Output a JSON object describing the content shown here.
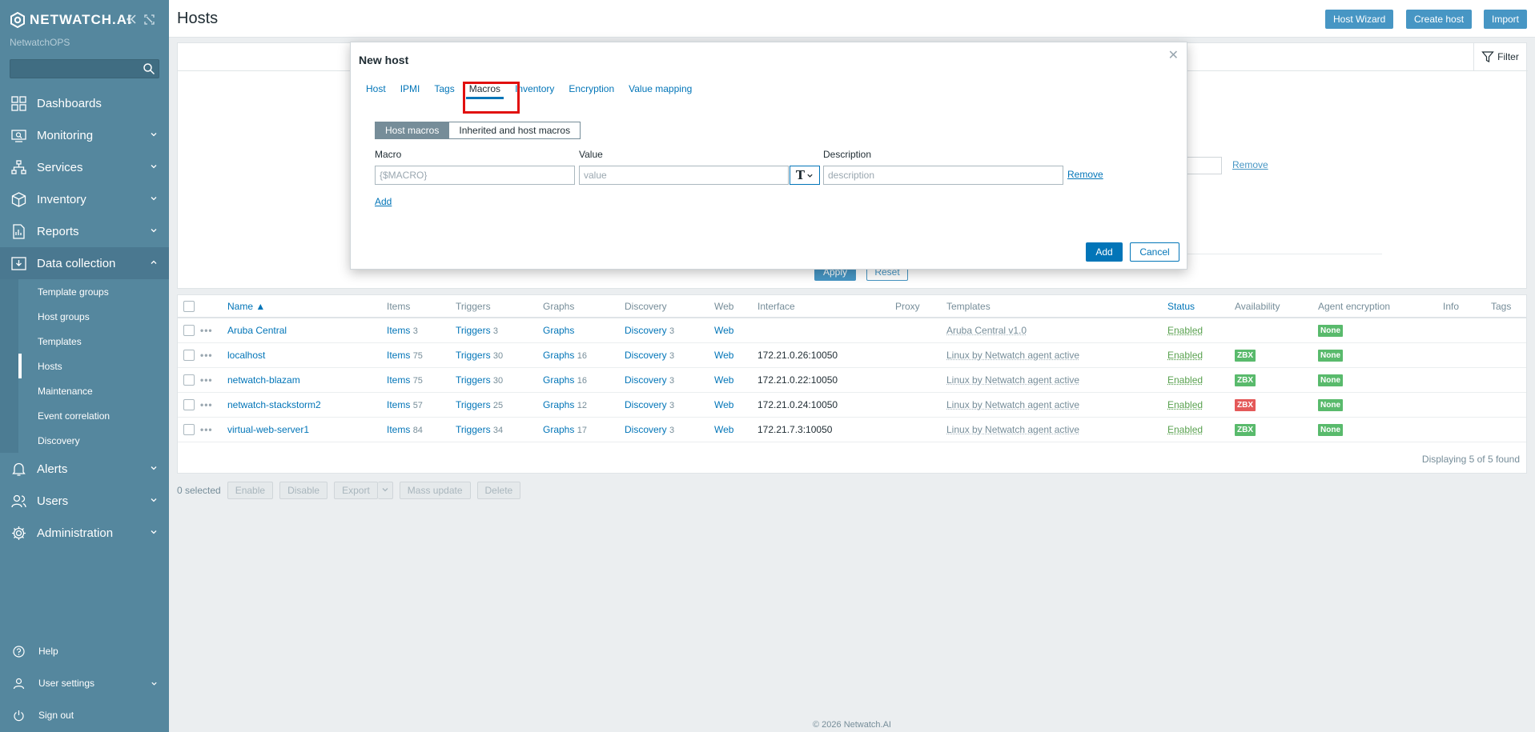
{
  "app": {
    "brand": "NETWATCH.AI",
    "subtitle": "NetwatchOPS",
    "search_placeholder": ""
  },
  "sidebar": {
    "menu": [
      {
        "label": "Dashboards",
        "icon": "dashboards-icon"
      },
      {
        "label": "Monitoring",
        "icon": "monitoring-icon"
      },
      {
        "label": "Services",
        "icon": "services-icon"
      },
      {
        "label": "Inventory",
        "icon": "inventory-icon"
      },
      {
        "label": "Reports",
        "icon": "reports-icon"
      },
      {
        "label": "Data collection",
        "icon": "data-collection-icon"
      }
    ],
    "submenu": [
      "Template groups",
      "Host groups",
      "Templates",
      "Hosts",
      "Maintenance",
      "Event correlation",
      "Discovery"
    ],
    "submenu_active": "Hosts",
    "menu_after": [
      {
        "label": "Alerts",
        "icon": "alerts-icon"
      },
      {
        "label": "Users",
        "icon": "users-icon"
      },
      {
        "label": "Administration",
        "icon": "administration-icon"
      }
    ],
    "bottom": [
      {
        "label": "Help",
        "icon": "help-icon"
      },
      {
        "label": "User settings",
        "icon": "user-settings-icon"
      },
      {
        "label": "Sign out",
        "icon": "sign-out-icon"
      }
    ]
  },
  "header": {
    "title": "Hosts",
    "buttons": {
      "wizard": "Host Wizard",
      "create": "Create host",
      "import": "Import"
    },
    "accent": "#4796c4"
  },
  "filter": {
    "tab_label": "Filter",
    "bg_remove": "Remove",
    "apply": "Apply",
    "reset": "Reset"
  },
  "table": {
    "headers": [
      "Name ▲",
      "Items",
      "Triggers",
      "Graphs",
      "Discovery",
      "Web",
      "Interface",
      "Proxy",
      "Templates",
      "Status",
      "Availability",
      "Agent encryption",
      "Info",
      "Tags"
    ],
    "rows": [
      {
        "name": "Aruba Central",
        "items": "Items",
        "items_n": "3",
        "triggers": "Triggers",
        "triggers_n": "3",
        "graphs": "Graphs",
        "graphs_n": "",
        "discovery": "Discovery",
        "discovery_n": "3",
        "web": "Web",
        "interface": "",
        "template": "Aruba Central v1.0",
        "status": "Enabled",
        "zbx": "",
        "encryption": "None"
      },
      {
        "name": "localhost",
        "items": "Items",
        "items_n": "75",
        "triggers": "Triggers",
        "triggers_n": "30",
        "graphs": "Graphs",
        "graphs_n": "16",
        "discovery": "Discovery",
        "discovery_n": "3",
        "web": "Web",
        "interface": "172.21.0.26:10050",
        "template": "Linux by Netwatch agent active",
        "status": "Enabled",
        "zbx": "ZBX",
        "zbx_color": "green",
        "encryption": "None"
      },
      {
        "name": "netwatch-blazam",
        "items": "Items",
        "items_n": "75",
        "triggers": "Triggers",
        "triggers_n": "30",
        "graphs": "Graphs",
        "graphs_n": "16",
        "discovery": "Discovery",
        "discovery_n": "3",
        "web": "Web",
        "interface": "172.21.0.22:10050",
        "template": "Linux by Netwatch agent active",
        "status": "Enabled",
        "zbx": "ZBX",
        "zbx_color": "green",
        "encryption": "None"
      },
      {
        "name": "netwatch-stackstorm2",
        "items": "Items",
        "items_n": "57",
        "triggers": "Triggers",
        "triggers_n": "25",
        "graphs": "Graphs",
        "graphs_n": "12",
        "discovery": "Discovery",
        "discovery_n": "3",
        "web": "Web",
        "interface": "172.21.0.24:10050",
        "template": "Linux by Netwatch agent active",
        "status": "Enabled",
        "zbx": "ZBX",
        "zbx_color": "red",
        "encryption": "None"
      },
      {
        "name": "virtual-web-server1",
        "items": "Items",
        "items_n": "84",
        "triggers": "Triggers",
        "triggers_n": "34",
        "graphs": "Graphs",
        "graphs_n": "17",
        "discovery": "Discovery",
        "discovery_n": "3",
        "web": "Web",
        "interface": "172.21.7.3:10050",
        "template": "Linux by Netwatch agent active",
        "status": "Enabled",
        "zbx": "ZBX",
        "zbx_color": "green",
        "encryption": "None"
      }
    ],
    "displaying": "Displaying 5 of 5 found"
  },
  "actions": {
    "selected": "0 selected",
    "enable": "Enable",
    "disable": "Disable",
    "export": "Export",
    "mass_update": "Mass update",
    "delete": "Delete"
  },
  "footer": "© 2026 Netwatch.AI",
  "modal": {
    "title": "New host",
    "tabs": [
      "Host",
      "IPMI",
      "Tags",
      "Macros",
      "Inventory",
      "Encryption",
      "Value mapping"
    ],
    "active_tab": "Macros",
    "segment": {
      "host_macros": "Host macros",
      "inherited": "Inherited and host macros"
    },
    "columns": {
      "macro": "Macro",
      "value": "Value",
      "description": "Description"
    },
    "placeholders": {
      "macro": "{$MACRO}",
      "value": "value",
      "description": "description"
    },
    "type_glyph": "T",
    "remove": "Remove",
    "add_link": "Add",
    "add_button": "Add",
    "cancel_button": "Cancel",
    "highlight_color": "#e1100f"
  }
}
